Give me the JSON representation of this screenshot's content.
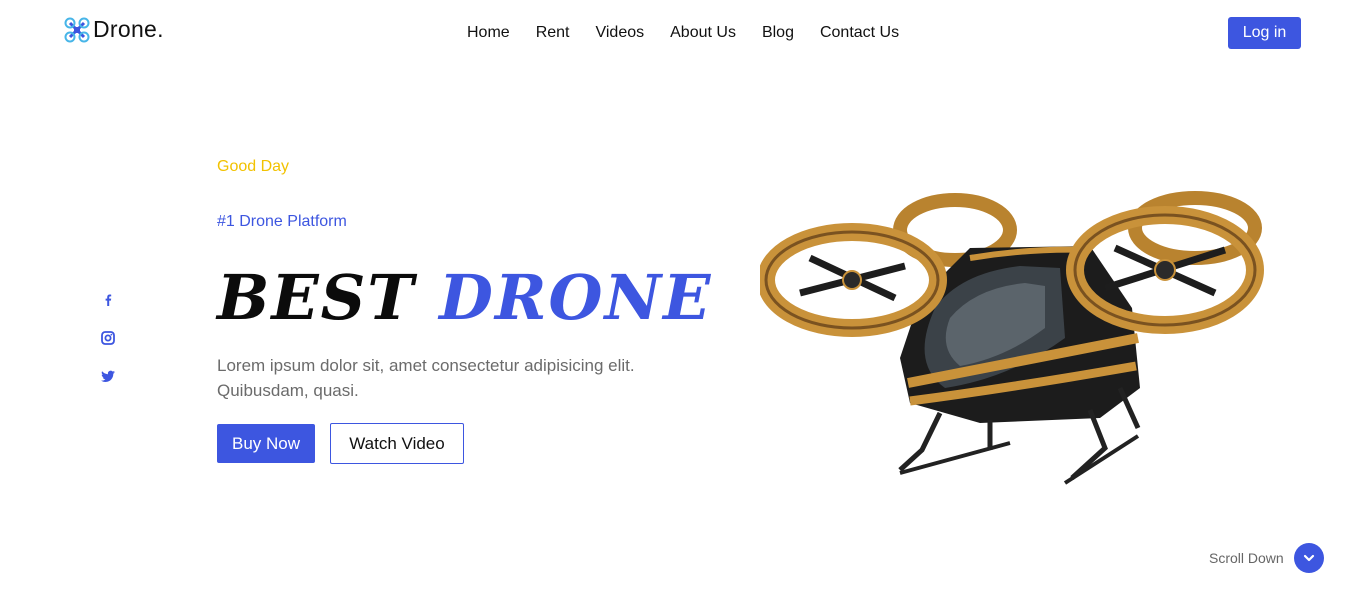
{
  "brand": {
    "name": "Drone.",
    "icon": "drone-logo-icon"
  },
  "nav": {
    "items": [
      "Home",
      "Rent",
      "Videos",
      "About Us",
      "Blog",
      "Contact Us"
    ]
  },
  "header": {
    "login_label": "Log in"
  },
  "hero": {
    "greeting": "Good Day",
    "tagline": "#1 Drone Platform",
    "title_dark": "Best",
    "title_blue": "Drone",
    "description": "Lorem ipsum dolor sit, amet consectetur adipisicing elit. Quibusdam, quasi.",
    "buy_label": "Buy Now",
    "watch_label": "Watch Video"
  },
  "social": {
    "icons": [
      "facebook-icon",
      "instagram-icon",
      "twitter-icon"
    ]
  },
  "scroll": {
    "label": "Scroll Down",
    "icon": "chevron-down-icon"
  },
  "colors": {
    "accent": "#3d56e0",
    "greeting": "#f2c200",
    "text": "#111111",
    "muted": "#6b6b6b",
    "drone_gold": "#c9923a"
  }
}
